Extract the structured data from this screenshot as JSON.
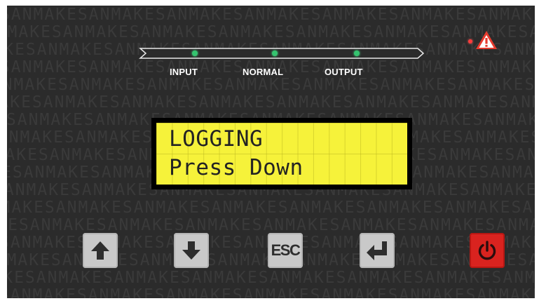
{
  "panel": {
    "watermark_text": "SANMAKE",
    "indicators": [
      {
        "label": "INPUT",
        "state": "on",
        "color": "#35c36f"
      },
      {
        "label": "NORMAL",
        "state": "on",
        "color": "#35c36f"
      },
      {
        "label": "OUTPUT",
        "state": "on",
        "color": "#35c36f"
      }
    ],
    "alarm": {
      "icon": "warning-triangle-icon",
      "dot_color": "#ff3b3b",
      "icon_color": "#e63b2e"
    },
    "lcd": {
      "line1": "LOGGING",
      "line2": "Press Down",
      "background": "#f6f23a"
    },
    "keys": [
      {
        "name": "up",
        "icon": "arrow-up-icon"
      },
      {
        "name": "down",
        "icon": "arrow-down-icon"
      },
      {
        "name": "esc",
        "label": "ESC"
      },
      {
        "name": "enter",
        "icon": "enter-icon"
      },
      {
        "name": "power",
        "icon": "power-icon",
        "color": "#d9231f"
      }
    ]
  }
}
